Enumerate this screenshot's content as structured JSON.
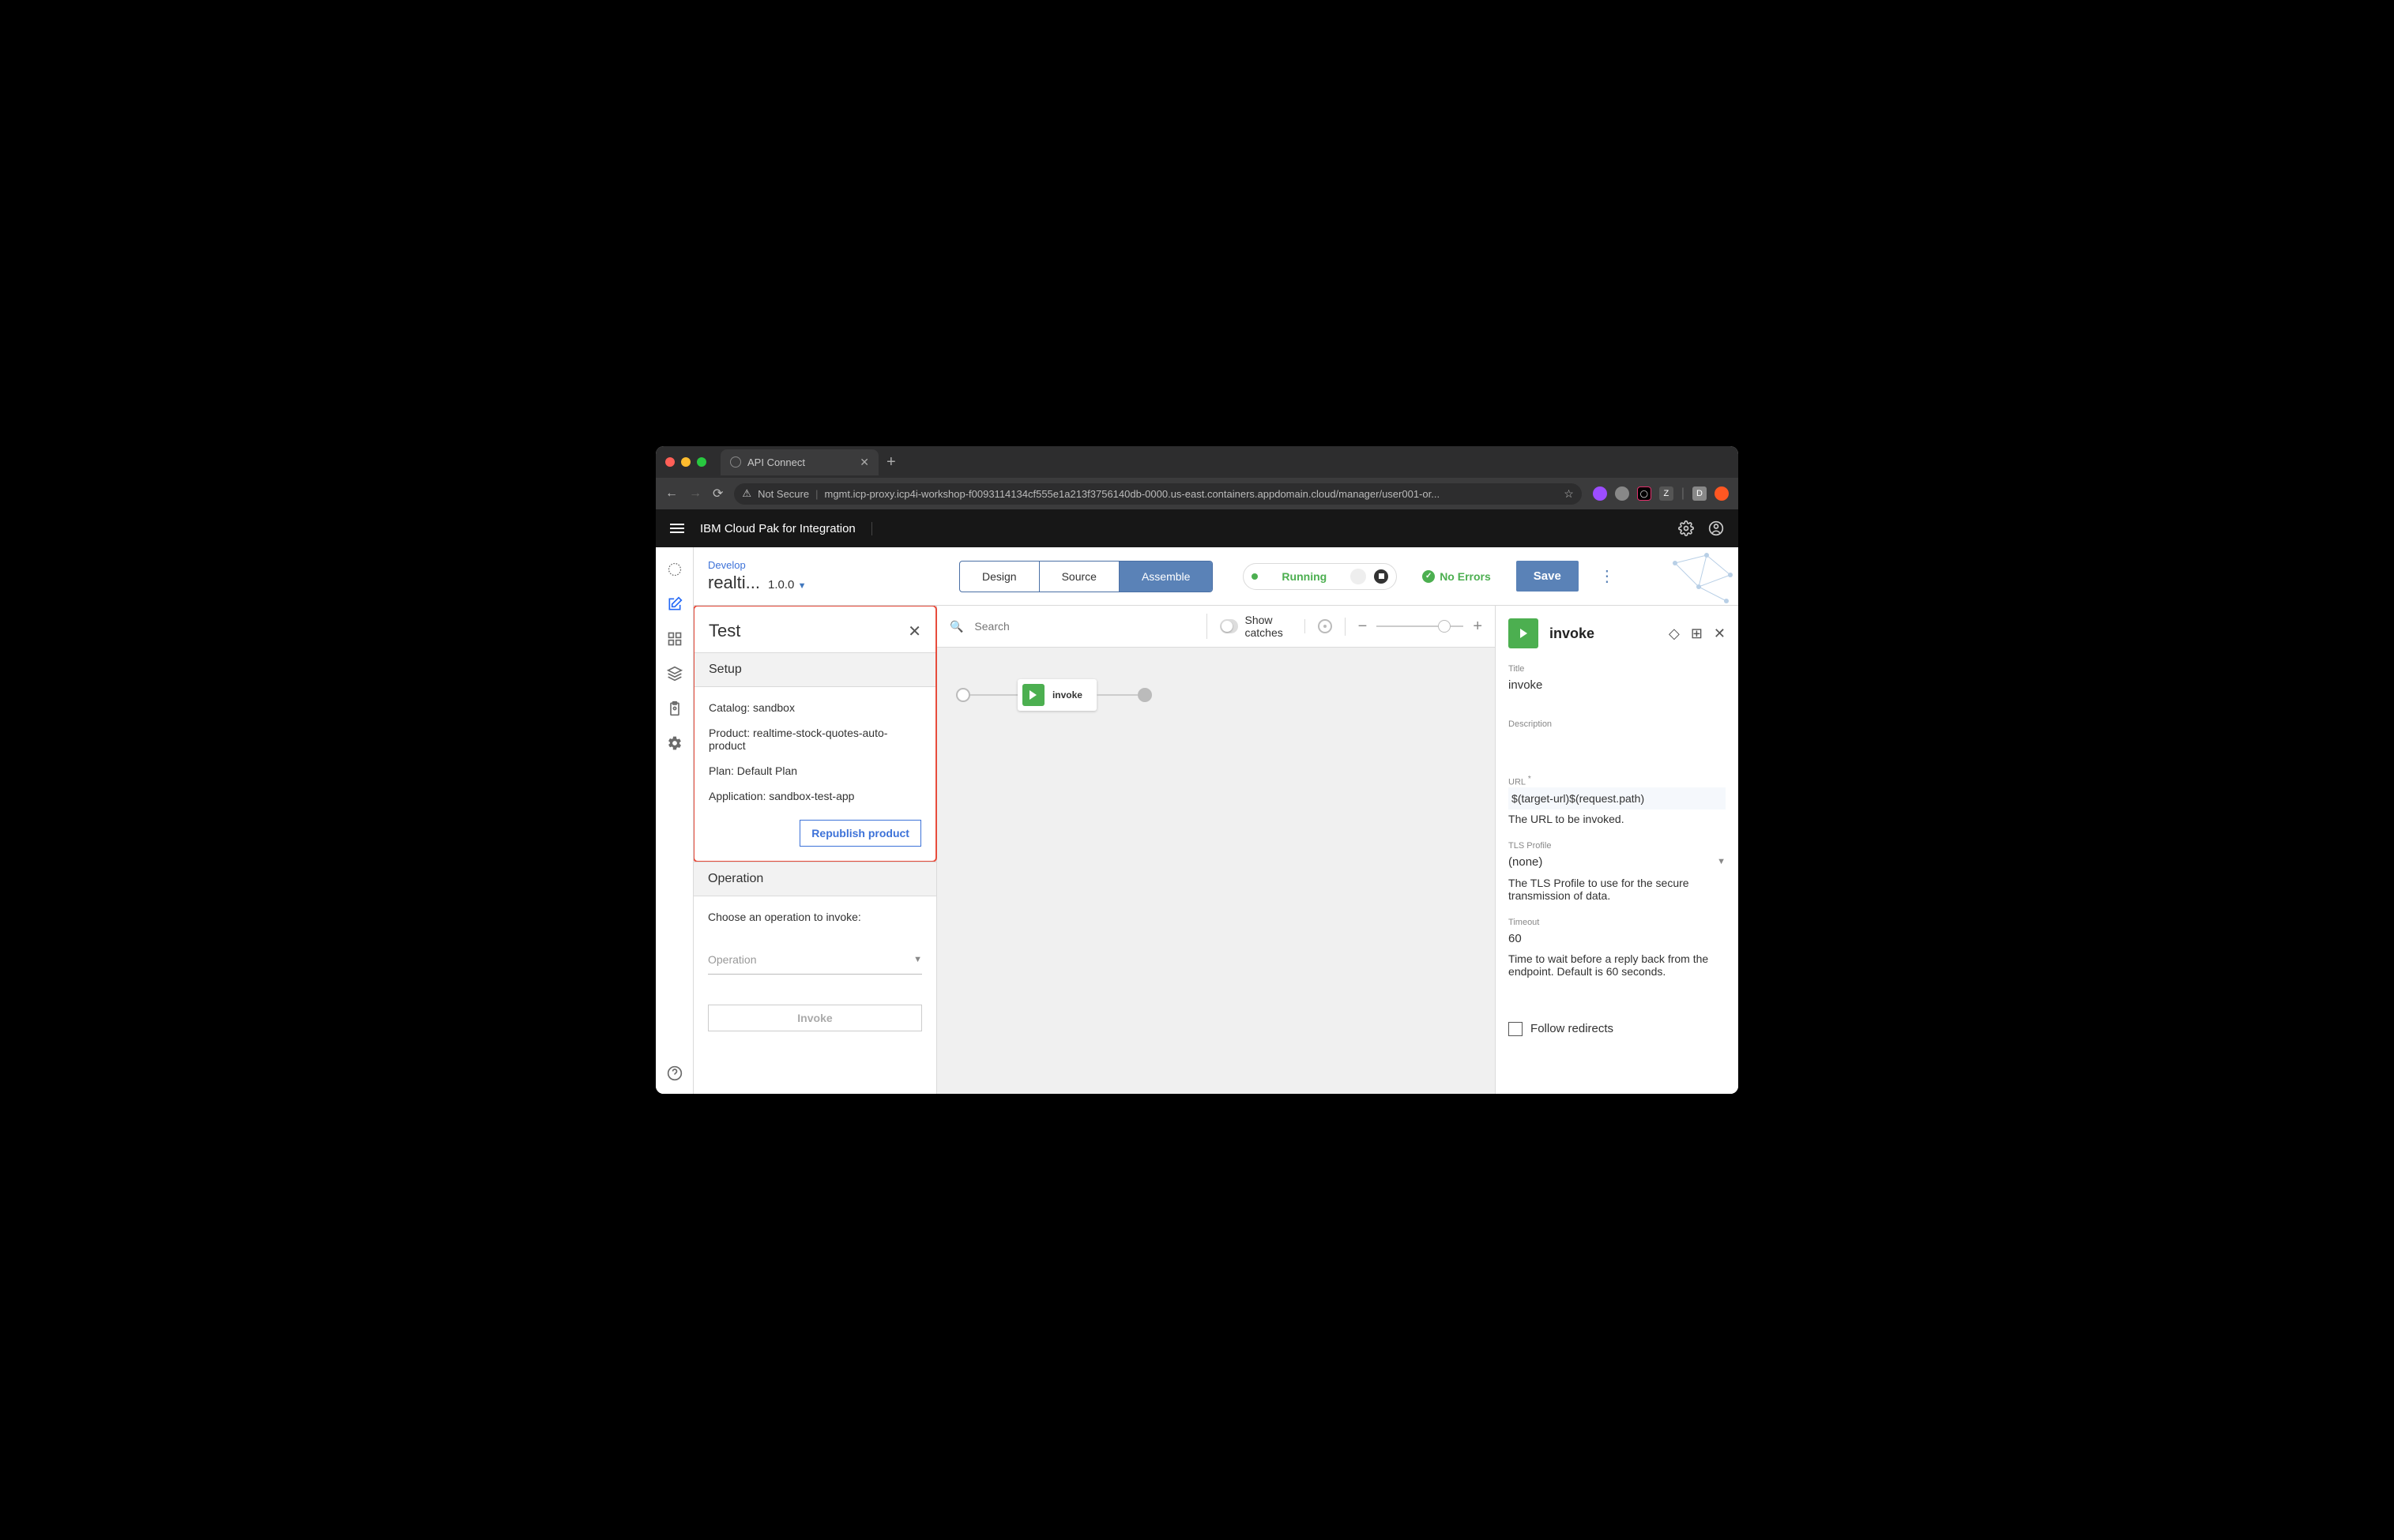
{
  "browser": {
    "tab_title": "API Connect",
    "not_secure_label": "Not Secure",
    "url": "mgmt.icp-proxy.icp4i-workshop-f0093114134cf555e1a213f3756140db-0000.us-east.containers.appdomain.cloud/manager/user001-or..."
  },
  "app_header": {
    "title": "IBM Cloud Pak for Integration"
  },
  "crumb": {
    "develop": "Develop",
    "api_name": "realti...",
    "version": "1.0.0"
  },
  "tabs": {
    "design": "Design",
    "source": "Source",
    "assemble": "Assemble"
  },
  "status": {
    "running": "Running",
    "no_errors": "No Errors",
    "save": "Save"
  },
  "search": {
    "placeholder": "Search"
  },
  "show_catches": "Show catches",
  "test_panel": {
    "title": "Test",
    "setup_header": "Setup",
    "catalog_label": "Catalog: sandbox",
    "product_label": "Product: realtime-stock-quotes-auto-product",
    "plan_label": "Plan: Default Plan",
    "application_label": "Application: sandbox-test-app",
    "republish": "Republish product",
    "operation_header": "Operation",
    "choose_op": "Choose an operation to invoke:",
    "op_placeholder": "Operation",
    "invoke_btn": "Invoke"
  },
  "flow": {
    "node_label": "invoke"
  },
  "props": {
    "title": "invoke",
    "fields": {
      "title_label": "Title",
      "title_value": "invoke",
      "desc_label": "Description",
      "url_label": "URL",
      "url_value": "$(target-url)$(request.path)",
      "url_help": "The URL to be invoked.",
      "tls_label": "TLS Profile",
      "tls_value": "(none)",
      "tls_help": "The TLS Profile to use for the secure transmission of data.",
      "timeout_label": "Timeout",
      "timeout_value": "60",
      "timeout_help": "Time to wait before a reply back from the endpoint. Default is 60 seconds.",
      "follow_redirects": "Follow redirects"
    }
  }
}
